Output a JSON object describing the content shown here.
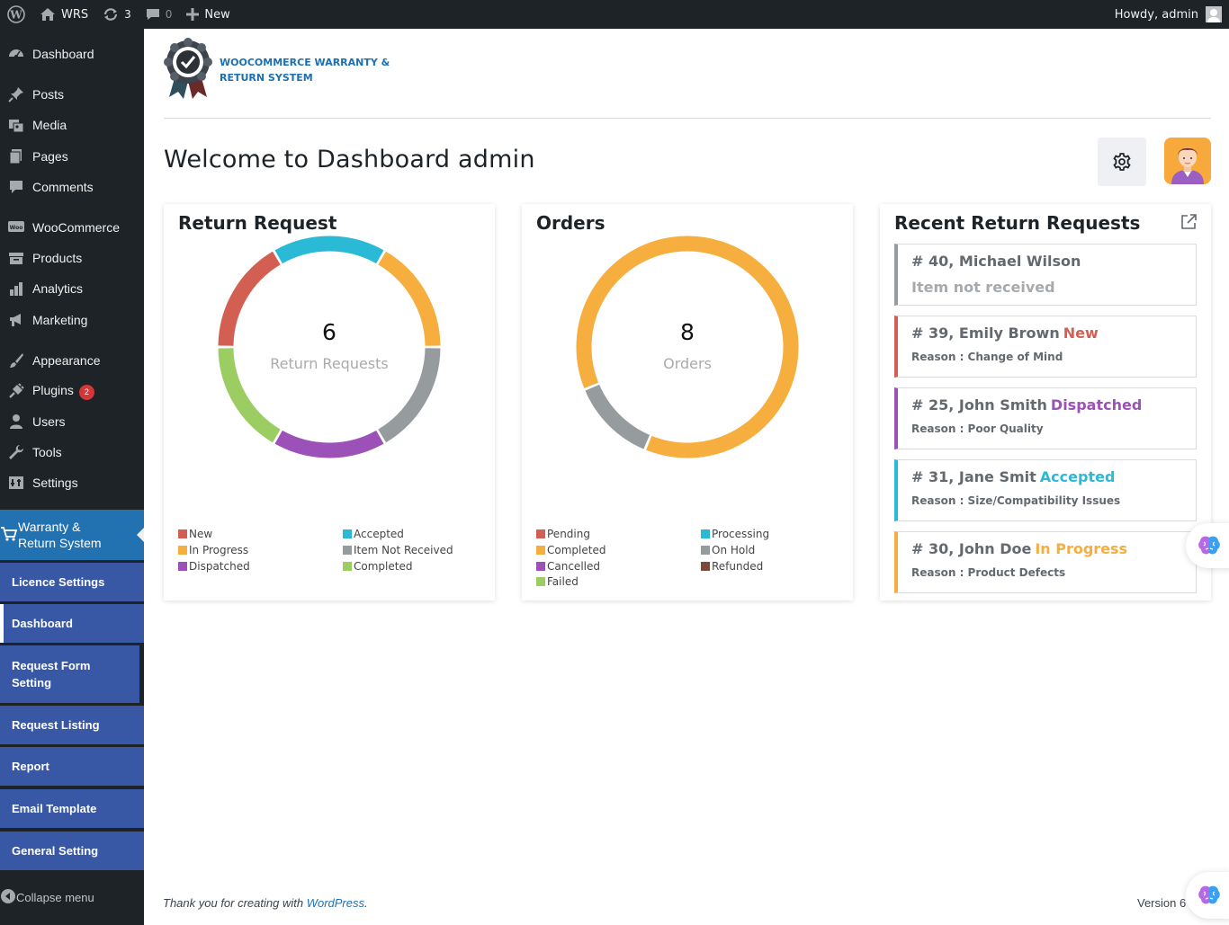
{
  "admin_bar": {
    "site_name": "WRS",
    "updates_count": "3",
    "comments_count": "0",
    "new_label": "New",
    "howdy": "Howdy, admin"
  },
  "sidebar": {
    "items": [
      {
        "label": "Dashboard",
        "icon": "dashboard-icon"
      },
      {
        "label": "Posts",
        "icon": "pin-icon"
      },
      {
        "label": "Media",
        "icon": "media-icon"
      },
      {
        "label": "Pages",
        "icon": "pages-icon"
      },
      {
        "label": "Comments",
        "icon": "comment-icon"
      },
      {
        "label": "WooCommerce",
        "icon": "woocommerce-icon"
      },
      {
        "label": "Products",
        "icon": "archive-icon"
      },
      {
        "label": "Analytics",
        "icon": "chart-bar-icon"
      },
      {
        "label": "Marketing",
        "icon": "megaphone-icon"
      },
      {
        "label": "Appearance",
        "icon": "brush-icon"
      },
      {
        "label": "Plugins",
        "icon": "plugin-icon",
        "badge": "2"
      },
      {
        "label": "Users",
        "icon": "user-icon"
      },
      {
        "label": "Tools",
        "icon": "wrench-icon"
      },
      {
        "label": "Settings",
        "icon": "settings-icon"
      }
    ],
    "active_menu": {
      "label_line1": "Warranty &",
      "label_line2": "Return System",
      "icon": "cart-icon"
    },
    "submenu": [
      {
        "label": "Licence Settings"
      },
      {
        "label": "Dashboard",
        "active": true
      },
      {
        "label": "Request Form Setting"
      },
      {
        "label": "Request Listing"
      },
      {
        "label": "Report"
      },
      {
        "label": "Email Template"
      },
      {
        "label": "General Setting"
      }
    ],
    "collapse_label": "Collapse menu"
  },
  "brand": {
    "line1": "WOOCOMMERCE WARRANTY &",
    "line2": "RETURN SYSTEM",
    "color": "#1b6fb2"
  },
  "welcome": "Welcome to Dashboard admin",
  "return_request_card": {
    "title": "Return Request",
    "total": "6",
    "subtitle": "Return Requests",
    "legend": [
      {
        "label": "New",
        "color": "#d35f52"
      },
      {
        "label": "Accepted",
        "color": "#2bbad6"
      },
      {
        "label": "In Progress",
        "color": "#f6ae3f"
      },
      {
        "label": "Item Not Received",
        "color": "#969b9e"
      },
      {
        "label": "Dispatched",
        "color": "#9b51b8"
      },
      {
        "label": "Completed",
        "color": "#9ccd63"
      }
    ]
  },
  "orders_card": {
    "title": "Orders",
    "total": "8",
    "subtitle": "Orders",
    "legend": [
      {
        "label": "Pending",
        "color": "#d35f52"
      },
      {
        "label": "Processing",
        "color": "#2bbad6"
      },
      {
        "label": "Completed",
        "color": "#f6ae3f"
      },
      {
        "label": "On Hold",
        "color": "#969b9e"
      },
      {
        "label": "Cancelled",
        "color": "#9b51b8"
      },
      {
        "label": "Refunded",
        "color": "#7c4a3a"
      },
      {
        "label": "Failed",
        "color": "#9ccd63"
      }
    ]
  },
  "chart_data": [
    {
      "type": "pie",
      "title": "Return Request",
      "categories": [
        "New",
        "Accepted",
        "In Progress",
        "Item Not Received",
        "Dispatched",
        "Completed"
      ],
      "values": [
        1,
        1,
        1,
        1,
        1,
        1
      ],
      "colors": [
        "#d35f52",
        "#2bbad6",
        "#f6ae3f",
        "#969b9e",
        "#9b51b8",
        "#9ccd63"
      ],
      "order_clockwise_from_top": [
        "Accepted",
        "In Progress",
        "Item Not Received",
        "Dispatched",
        "Completed",
        "New"
      ]
    },
    {
      "type": "pie",
      "title": "Orders",
      "categories": [
        "Pending",
        "Processing",
        "Completed",
        "On Hold",
        "Cancelled",
        "Refunded",
        "Failed"
      ],
      "values": [
        0,
        0,
        7,
        1,
        0,
        0,
        0
      ],
      "colors": [
        "#d35f52",
        "#2bbad6",
        "#f6ae3f",
        "#969b9e",
        "#9b51b8",
        "#7c4a3a",
        "#9ccd63"
      ]
    }
  ],
  "recent_requests": {
    "title": "Recent Return Requests",
    "items": [
      {
        "title": "# 40, Michael Wilson",
        "status": "",
        "status_color": "#969b9e",
        "subtitle": "Item not received",
        "border_color": "#969b9e"
      },
      {
        "title": "# 39, Emily Brown",
        "status": "New",
        "status_color": "#d35f52",
        "subtitle": "Reason : Change of Mind",
        "border_color": "#d35f52"
      },
      {
        "title": "# 25, John Smith",
        "status": "Dispatched",
        "status_color": "#9b51b8",
        "subtitle": "Reason : Poor Quality",
        "border_color": "#9b51b8"
      },
      {
        "title": "# 31, Jane Smit",
        "status": "Accepted",
        "status_color": "#2bbad6",
        "subtitle": "Reason : Size/Compatibility Issues",
        "border_color": "#2bbad6"
      },
      {
        "title": "# 30, John Doe",
        "status": "In Progress",
        "status_color": "#f6ae3f",
        "subtitle": "Reason : Product Defects",
        "border_color": "#f6ae3f"
      }
    ]
  },
  "footer": {
    "text_before": "Thank you for creating with ",
    "link": "WordPress",
    "text_after": ".",
    "version": "Version 6"
  }
}
